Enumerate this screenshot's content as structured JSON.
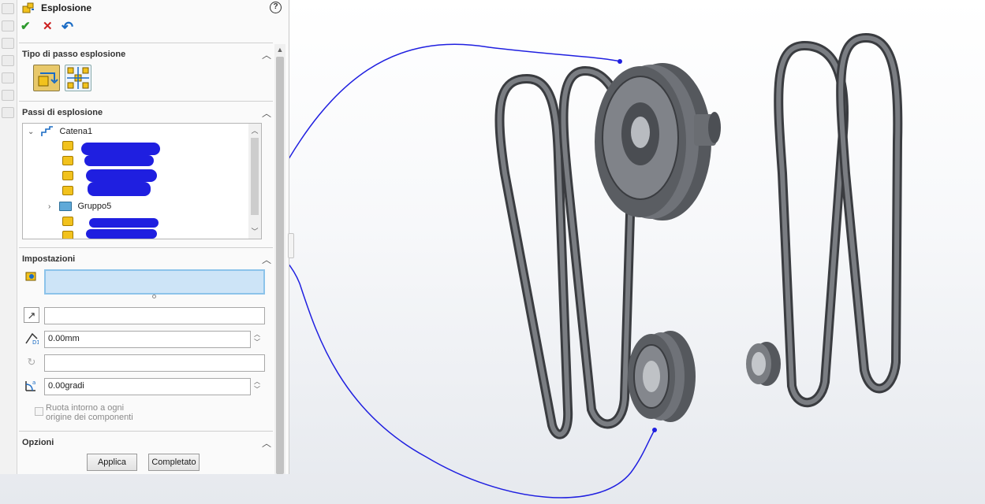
{
  "panel": {
    "title": "Esplosione",
    "help": "?",
    "actions": {
      "ok": "✔",
      "cancel": "✕",
      "undo": "↶"
    }
  },
  "sections": {
    "step_type": {
      "label": "Tipo di passo esplosione"
    },
    "steps": {
      "label": "Passi di esplosione"
    },
    "settings": {
      "label": "Impostazioni"
    },
    "options": {
      "label": "Opzioni"
    }
  },
  "tree": {
    "root": "Catena1",
    "group": "Gruppo5"
  },
  "settings": {
    "distance_value": "0.00mm",
    "angle_value": "0.00gradi",
    "rotate_label_line1": "Ruota intorno a ogni",
    "rotate_label_line2": "origine dei componenti"
  },
  "buttons": {
    "apply": "Applica",
    "done": "Completato"
  },
  "colors": {
    "annotation": "#1f1fe0",
    "model_metal": "#6f7278",
    "model_dark": "#3a3c40",
    "selection_field": "#cde4f7"
  }
}
